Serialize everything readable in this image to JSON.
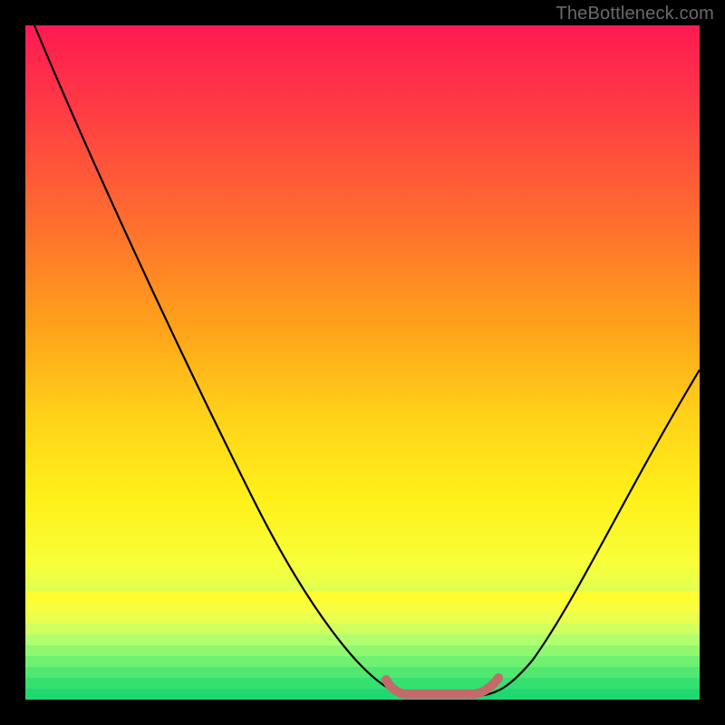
{
  "watermark": "TheBottleneck.com",
  "chart_data": {
    "type": "line",
    "title": "",
    "xlabel": "",
    "ylabel": "",
    "xlim": [
      0,
      100
    ],
    "ylim": [
      0,
      100
    ],
    "series": [
      {
        "name": "bottleneck-curve",
        "x": [
          0,
          10,
          20,
          30,
          40,
          50,
          55,
          58,
          60,
          64,
          68,
          72,
          80,
          90,
          100
        ],
        "y": [
          100,
          80,
          58,
          38,
          22,
          8,
          2,
          0,
          0,
          0,
          0,
          2,
          12,
          28,
          46
        ]
      },
      {
        "name": "optimal-range-marker",
        "x": [
          55,
          58,
          60,
          64,
          68,
          70
        ],
        "y": [
          2,
          0,
          0,
          0,
          0,
          2
        ]
      }
    ],
    "colors": {
      "curve": "#000000",
      "marker": "#c06060",
      "gradient_top": "#ff1a52",
      "gradient_bottom": "#20e870"
    }
  }
}
